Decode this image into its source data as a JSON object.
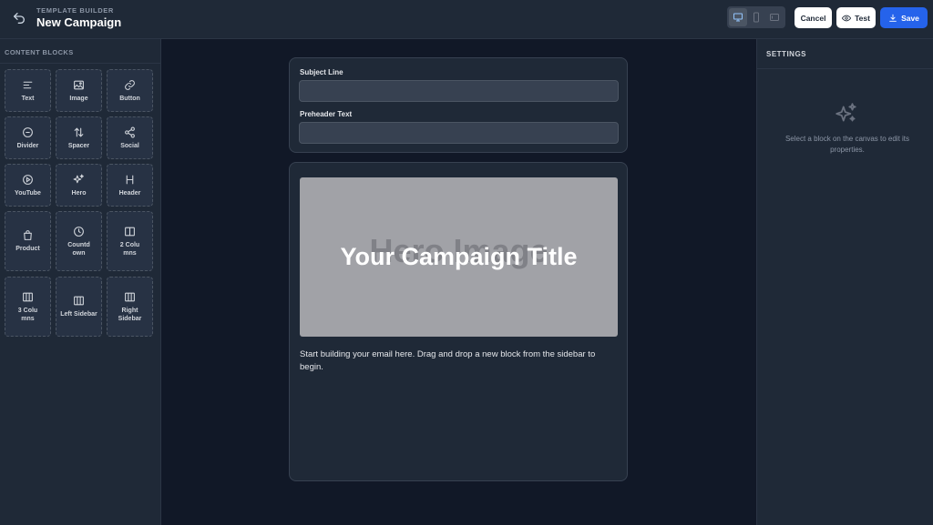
{
  "header": {
    "kicker": "TEMPLATE BUILDER",
    "title": "New Campaign",
    "devices": [
      "desktop",
      "mobile",
      "tablet"
    ],
    "active_device": "desktop",
    "cancel_label": "Cancel",
    "test_label": "Test",
    "save_label": "Save",
    "accent_color": "#2563eb"
  },
  "sidebar": {
    "heading": "CONTENT BLOCKS",
    "blocks": [
      {
        "label": "Text",
        "icon": "text-align-icon"
      },
      {
        "label": "Image",
        "icon": "image-icon"
      },
      {
        "label": "Button",
        "icon": "link-icon"
      },
      {
        "label": "Divider",
        "icon": "minus-circle-icon"
      },
      {
        "label": "Spacer",
        "icon": "arrows-vertical-icon"
      },
      {
        "label": "Social",
        "icon": "share-icon"
      },
      {
        "label": "YouTube",
        "icon": "play-circle-icon"
      },
      {
        "label": "Hero",
        "icon": "sparkles-icon"
      },
      {
        "label": "Header",
        "icon": "heading-icon"
      },
      {
        "label": "Product",
        "icon": "shopping-bag-icon"
      },
      {
        "label": "Countdown",
        "icon": "clock-icon"
      },
      {
        "label": "2 Columns",
        "icon": "columns-icon"
      },
      {
        "label": "3 Columns",
        "icon": "columns-icon"
      },
      {
        "label": "Left Sidebar",
        "icon": "columns-icon"
      },
      {
        "label": "Right Sidebar",
        "icon": "columns-icon"
      }
    ]
  },
  "canvas": {
    "subject_label": "Subject Line",
    "subject_value": "",
    "preheader_label": "Preheader Text",
    "preheader_value": "",
    "hero_placeholder": "Hero Image",
    "hero_title": "Your Campaign Title",
    "body_text": "Start building your email here. Drag and drop a new block from the sidebar to begin."
  },
  "settings": {
    "heading": "SETTINGS",
    "hint": "Select a block on the canvas to edit its properties."
  }
}
